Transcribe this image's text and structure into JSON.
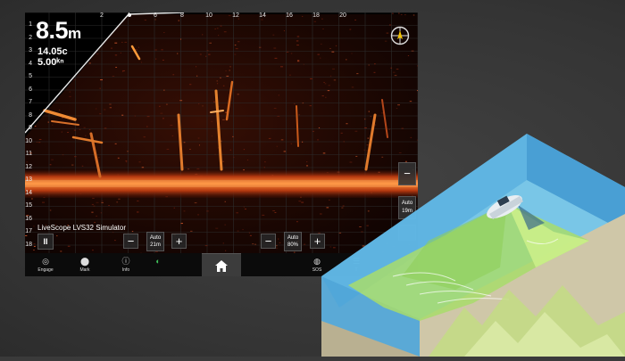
{
  "sonar": {
    "depth_value": "8.5",
    "depth_unit": "m",
    "temperature": "14.05c",
    "speed": "5.00ᵏⁿ",
    "simulator_label": "LiveScope LVS32 Simulator",
    "depth_scale": [
      "1",
      "2",
      "3",
      "4",
      "5",
      "6",
      "7",
      "8",
      "9",
      "10",
      "11",
      "12",
      "13",
      "14",
      "15",
      "16",
      "17",
      "18"
    ],
    "range_scale": [
      "2",
      "4",
      "6",
      "8",
      "10",
      "12",
      "14",
      "16",
      "18",
      "20"
    ]
  },
  "controls": {
    "pause_label": "II",
    "minus_label": "−",
    "plus_label": "+",
    "range_auto_label": "Auto",
    "range_auto_value": "21m",
    "gain_auto_label": "Auto",
    "gain_auto_value": "80%",
    "side_minus_label": "−",
    "side_auto_label": "Auto",
    "side_auto_value": "19m"
  },
  "bottom_bar": {
    "items": [
      {
        "label": "Engage",
        "icon": "engage-icon"
      },
      {
        "label": "Mark",
        "icon": "waypoint-icon"
      },
      {
        "label": "Info",
        "icon": "info-icon"
      },
      {
        "label": "",
        "icon": "globe-icon"
      },
      {
        "label": "",
        "icon": "home-icon"
      },
      {
        "label": "SOS",
        "icon": "sos-icon"
      },
      {
        "label": "T",
        "icon": "menu-icon"
      }
    ]
  },
  "colors": {
    "sonar_bg": "#000000",
    "echo_hot": "#ff8a2a",
    "echo_warm": "#c0391a",
    "grid": "#2b2b2b",
    "water_blue": "#5ab8e6",
    "beam_green": "#b9e27a"
  }
}
